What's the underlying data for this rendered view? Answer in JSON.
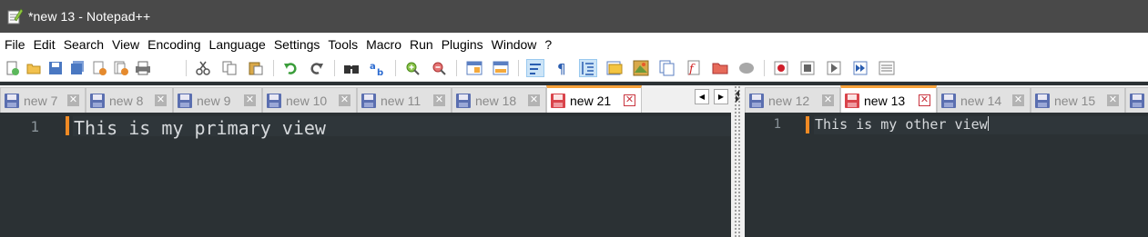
{
  "window": {
    "title": "*new 13 - Notepad++"
  },
  "menu": [
    "File",
    "Edit",
    "Search",
    "View",
    "Encoding",
    "Language",
    "Settings",
    "Tools",
    "Macro",
    "Run",
    "Plugins",
    "Window",
    "?"
  ],
  "toolbar": {
    "icons": [
      "new-file-icon",
      "open-file-icon",
      "save-icon",
      "save-all-icon",
      "close-icon",
      "close-all-icon",
      "print-icon",
      "cut-icon",
      "copy-icon",
      "paste-icon",
      "undo-icon",
      "redo-icon",
      "find-icon",
      "replace-icon",
      "zoom-in-icon",
      "zoom-out-icon",
      "sync-vertical-icon",
      "sync-horizontal-icon",
      "word-wrap-icon",
      "show-all-chars-icon",
      "indent-guide-icon",
      "user-language-icon",
      "document-map-icon",
      "document-list-icon",
      "function-list-icon",
      "folder-as-workspace-icon",
      "monitoring-icon",
      "record-macro-icon",
      "stop-macro-icon",
      "play-macro-icon",
      "run-macro-multiple-icon",
      "save-macro-icon"
    ]
  },
  "left_view": {
    "tabs": [
      {
        "label": "new 7",
        "active": false
      },
      {
        "label": "new 8",
        "active": false
      },
      {
        "label": "new 9",
        "active": false
      },
      {
        "label": "new 10",
        "active": false
      },
      {
        "label": "new 11",
        "active": false
      },
      {
        "label": "new 18",
        "active": false
      },
      {
        "label": "new 21",
        "active": true
      }
    ],
    "line_number": "1",
    "text": "This is my primary view"
  },
  "right_view": {
    "tabs": [
      {
        "label": "new 12",
        "active": false
      },
      {
        "label": "new 13",
        "active": true
      },
      {
        "label": "new 14",
        "active": false
      },
      {
        "label": "new 15",
        "active": false
      }
    ],
    "line_number": "1",
    "text": "This is my other view"
  },
  "colors": {
    "titlebar": "#494949",
    "editor_bg": "#2b3134",
    "active_tab_accent": "#f7a13a",
    "change_marker": "#f08a24",
    "saved_disk": "#5b6fb0",
    "unsaved_disk": "#d9444b"
  }
}
